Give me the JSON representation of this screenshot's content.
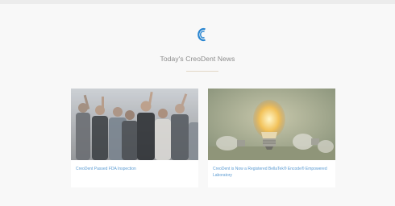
{
  "brand": {
    "logo_icon": "creodent-c-logo-icon",
    "accent": "#2a86d1"
  },
  "section": {
    "title": "Today's CreoDent News"
  },
  "news": [
    {
      "title": "CreoDent Passed FDA Inspection",
      "image_icon": "celebrating-team-photo"
    },
    {
      "title": "CreoDent is Now a Registered BellaTek® Encode® Empowered Laboratory",
      "image_icon": "light-bulb-photo"
    }
  ],
  "colors": {
    "link": "#5b9bd2",
    "heading": "#8b8b8b",
    "divider": "#e3d8c6"
  }
}
